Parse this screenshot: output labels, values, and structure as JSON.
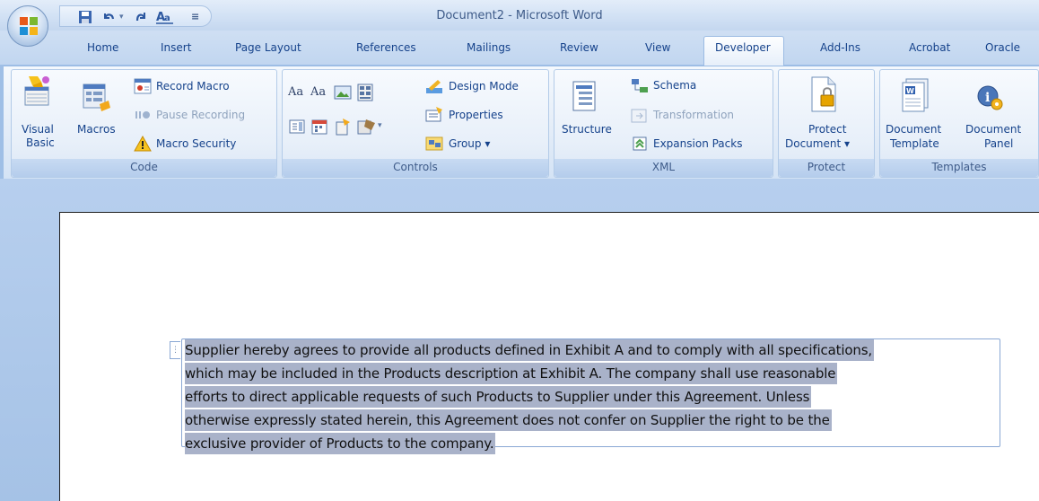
{
  "window": {
    "title": "Document2 - Microsoft Word"
  },
  "quick_access": {
    "save_icon": "save-icon",
    "undo_icon": "undo-icon",
    "redo_icon": "redo-icon",
    "format_icon": "spelling-icon",
    "customize_glyph": "≡"
  },
  "tabs": [
    {
      "label": "Home"
    },
    {
      "label": "Insert"
    },
    {
      "label": "Page Layout"
    },
    {
      "label": "References"
    },
    {
      "label": "Mailings"
    },
    {
      "label": "Review"
    },
    {
      "label": "View"
    },
    {
      "label": "Developer"
    },
    {
      "label": "Add-Ins"
    },
    {
      "label": "Acrobat"
    },
    {
      "label": "Oracle"
    }
  ],
  "ribbon": {
    "code": {
      "label": "Code",
      "visual_basic_line1": "Visual",
      "visual_basic_line2": "Basic",
      "macros": "Macros",
      "record_macro": "Record Macro",
      "pause_recording": "Pause Recording",
      "macro_security": "Macro Security"
    },
    "controls": {
      "label": "Controls",
      "rich_text_glyph": "Aa",
      "plain_text_glyph": "Aa",
      "design_mode": "Design Mode",
      "properties": "Properties",
      "group": "Group ▾"
    },
    "xml": {
      "label": "XML",
      "structure": "Structure",
      "schema": "Schema",
      "transformation": "Transformation",
      "expansion_packs": "Expansion Packs"
    },
    "protect": {
      "label": "Protect",
      "protect_line1": "Protect",
      "protect_line2": "Document ▾"
    },
    "templates": {
      "label": "Templates",
      "doc_template_line1": "Document",
      "doc_template_line2": "Template",
      "doc_panel_line1": "Document",
      "doc_panel_line2": "Panel"
    }
  },
  "document": {
    "content_control_handle": "⋮",
    "lines": [
      "Supplier hereby agrees to provide all products defined in Exhibit A and to comply with all specifications,",
      "which may be included in the Products description at Exhibit A.  The company shall use reasonable",
      "efforts to direct applicable requests of such Products to Supplier under this Agreement.  Unless",
      "otherwise expressly stated herein, this Agreement does not confer on Supplier the right to be the",
      "exclusive provider of Products to the company."
    ]
  },
  "colors": {
    "ribbon_text": "#15428b",
    "selection_highlight": "#a9b2c9",
    "developer_tab_bg": "#fdfeff"
  }
}
